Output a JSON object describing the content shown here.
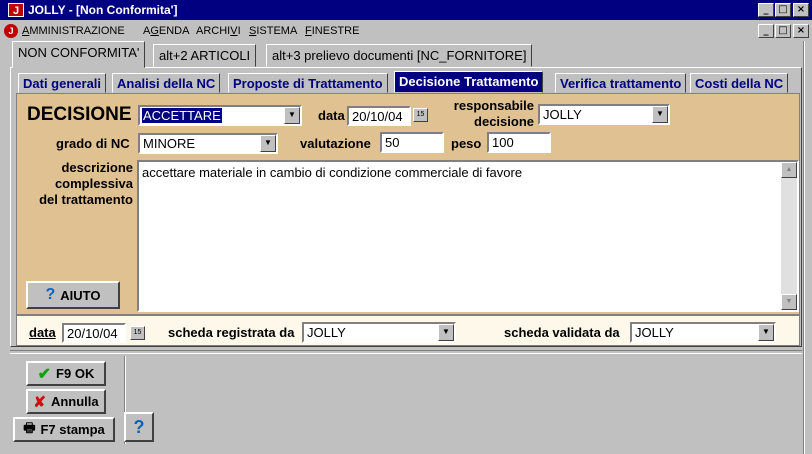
{
  "window": {
    "title": "JOLLY - [Non Conformita']",
    "app_icon": "J",
    "minimize": "_",
    "maximize": "□",
    "close": "×",
    "restore": "ð"
  },
  "menu": {
    "icon": "J",
    "items": [
      {
        "label": "AMMINISTRAZIONE",
        "mnemonic": "A"
      },
      {
        "label": "AGENDA",
        "mnemonic": "G"
      },
      {
        "label": "ARCHIVI",
        "mnemonic": "V"
      },
      {
        "label": "SISTEMA",
        "mnemonic": "S"
      },
      {
        "label": "FINESTRE",
        "mnemonic": "F"
      }
    ]
  },
  "outer_tabs": [
    "NON CONFORMITA'",
    "alt+2  ARTICOLI",
    "alt+3  prelievo documenti [NC_FORNITORE]"
  ],
  "inner_tabs": [
    "Dati generali",
    "Analisi della NC",
    "Proposte di Trattamento",
    "Decisione Trattamento",
    "Verifica trattamento",
    "Costi della NC"
  ],
  "form": {
    "decisione_label": "DECISIONE",
    "decisione_value": "ACCETTARE",
    "data_label": "data",
    "data_value": "20/10/04",
    "responsabile_label_1": "responsabile",
    "responsabile_label_2": "decisione",
    "responsabile_value": "JOLLY",
    "grado_label": "grado di NC",
    "grado_value": "MINORE",
    "valutazione_label": "valutazione",
    "valutazione_value": "50",
    "peso_label": "peso",
    "peso_value": "100",
    "descrizione_label_1": "descrizione",
    "descrizione_label_2": "complessiva",
    "descrizione_label_3": "del trattamento",
    "descrizione_value": "accettare materiale in cambio di condizione commerciale di favore",
    "aiuto_label": "AIUTO",
    "calendar_icon": "15"
  },
  "bottom": {
    "data_label": "data",
    "data_value": "20/10/04",
    "registrata_label": "scheda registrata da",
    "registrata_value": "JOLLY",
    "validata_label": "scheda validata da",
    "validata_value": "JOLLY"
  },
  "buttons": {
    "ok": "F9 OK",
    "annulla": "Annulla",
    "stampa": "F7 stampa",
    "help": "?"
  },
  "colors": {
    "titlebar": "#000080",
    "panel": "#e0c292",
    "active_tab": "#000080"
  }
}
